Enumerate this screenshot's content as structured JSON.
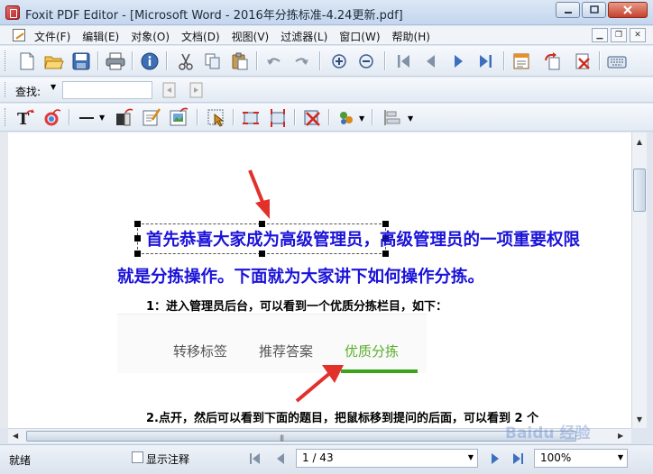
{
  "window": {
    "title": "Foxit PDF Editor - [Microsoft Word - 2016年分拣标准-4.24更新.pdf]",
    "controls": [
      "minimize",
      "maximize",
      "close"
    ]
  },
  "menu": {
    "items": [
      "文件(F)",
      "编辑(E)",
      "对象(O)",
      "文档(D)",
      "视图(V)",
      "过滤器(L)",
      "窗口(W)",
      "帮助(H)"
    ]
  },
  "toolbar1": {
    "buttons": [
      "new-icon",
      "open-icon",
      "save-icon",
      "print-icon",
      "info-icon",
      "cut-icon",
      "copy-icon",
      "paste-icon",
      "undo-icon",
      "redo-icon",
      "zoom-in-icon",
      "zoom-out-icon",
      "first-page-icon",
      "prev-page-icon",
      "next-page-icon",
      "last-page-icon",
      "properties-icon",
      "rotate-icon",
      "delete-icon",
      "keyboard-icon"
    ]
  },
  "toolbar2": {
    "find_label": "查找:",
    "find_value": ""
  },
  "toolbar3": {
    "buttons": [
      "text-tool-icon",
      "color-icon",
      "line-icon",
      "shape-icon",
      "edit-text-icon",
      "image-icon",
      "select-icon",
      "crop-icon",
      "crop2-icon",
      "delete-object-icon",
      "group-icon",
      "align-icon"
    ]
  },
  "document": {
    "line1": "首先恭喜大家成为高级管理员，高级管理员的一项重要权限",
    "line2": "就是分拣操作。下面就为大家讲下如何操作分拣。",
    "step1": "1：进入管理员后台，可以看到一个优质分拣栏目，如下：",
    "step2": "2.点开，然后可以看到下面的题目，把鼠标移到提问的后面，可以看到 2 个",
    "embed_tabs": [
      "转移标签",
      "推荐答案",
      "优质分拣"
    ],
    "active_tab": "优质分拣",
    "accent_color": "#1a12d8",
    "tab_active_color": "#5aad2a"
  },
  "status": {
    "ready": "就绪",
    "show_annotations": "显示注释",
    "page": "1 / 43",
    "zoom": "100%",
    "watermark": "Baidu 经验"
  }
}
